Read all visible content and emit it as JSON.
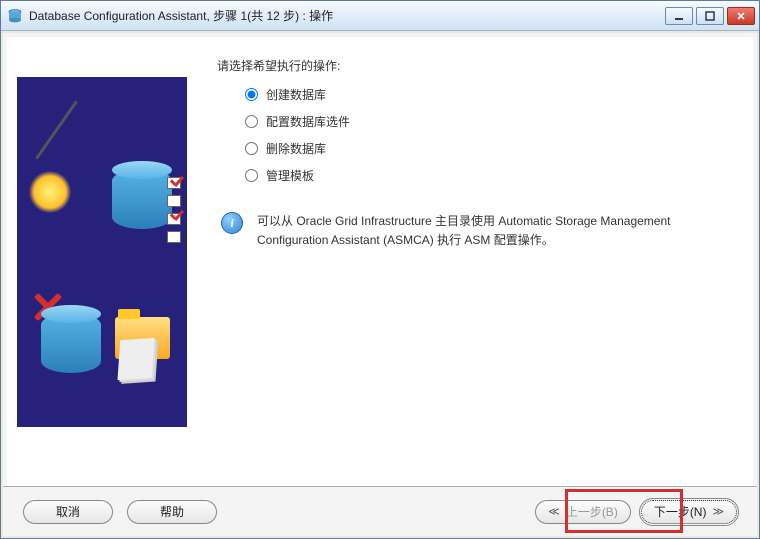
{
  "window": {
    "title": "Database Configuration Assistant, 步骤 1(共 12 步) : 操作"
  },
  "prompt": "请选择希望执行的操作:",
  "options": {
    "create": "创建数据库",
    "configure": "配置数据库选件",
    "delete": "删除数据库",
    "manage": "管理模板"
  },
  "selected": "create",
  "info": {
    "text": "可以从 Oracle Grid Infrastructure 主目录使用 Automatic Storage Management Configuration Assistant (ASMCA) 执行 ASM 配置操作。"
  },
  "buttons": {
    "cancel": "取消",
    "help": "帮助",
    "back": "上一步(B)",
    "next": "下一步(N)"
  },
  "icons": {
    "info_glyph": "i"
  }
}
